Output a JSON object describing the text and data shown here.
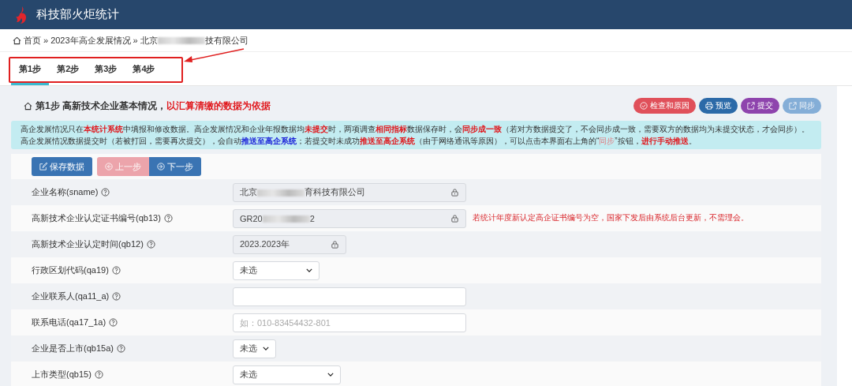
{
  "app": {
    "title": "科技部火炬统计"
  },
  "breadcrumb": {
    "home": "首页",
    "separator": "»",
    "items": [
      "2023年高企发展情况"
    ],
    "current_start": "北京",
    "current_end": "技有限公司"
  },
  "tabs": [
    {
      "label": "第1步",
      "selected": true
    },
    {
      "label": "第2步",
      "selected": false
    },
    {
      "label": "第3步",
      "selected": false
    },
    {
      "label": "第4步",
      "selected": false
    }
  ],
  "section": {
    "title": "第1步 高新技术企业基本情况，",
    "title_note": "以汇算清缴的数据为依据"
  },
  "actions": [
    {
      "label": "检查和原因",
      "kind": "check",
      "disabled": false
    },
    {
      "label": "预览",
      "kind": "print",
      "disabled": false
    },
    {
      "label": "提交",
      "kind": "submit",
      "disabled": false
    },
    {
      "label": "同步",
      "kind": "sync",
      "disabled": true
    }
  ],
  "notice": [
    {
      "text": "高企发展情况只在",
      "kind": "plain"
    },
    {
      "text": "本统计系统",
      "kind": "alert"
    },
    {
      "text": "中填报和修改数据。高企发展情况和企业年报数据均",
      "kind": "plain"
    },
    {
      "text": "未提交",
      "kind": "alert"
    },
    {
      "text": "时，两项调查",
      "kind": "plain"
    },
    {
      "text": "相同指标",
      "kind": "alert"
    },
    {
      "text": "数据保存时，会",
      "kind": "plain"
    },
    {
      "text": "同步成一致",
      "kind": "alert"
    },
    {
      "text": "（若对方数据提交了，不会同步成一致，需要双方的数据均为未提交状态，才会同步）。高企发展情况数据提交时（若被打回，需要再次提交），会自动",
      "kind": "plain"
    },
    {
      "text": "推送至高企系统",
      "kind": "link"
    },
    {
      "text": "；若提交时未成功",
      "kind": "plain"
    },
    {
      "text": "推送至高企系统",
      "kind": "alert"
    },
    {
      "text": "（由于网络通讯等原因），可以点击本界面右上角的“",
      "kind": "plain"
    },
    {
      "text": "同步",
      "kind": "quote"
    },
    {
      "text": "”按钮，",
      "kind": "plain"
    },
    {
      "text": "进行手动推送",
      "kind": "alert"
    },
    {
      "text": "。",
      "kind": "plain"
    }
  ],
  "toolbar": [
    {
      "label": "保存数据",
      "kind": "save",
      "disabled": false
    },
    {
      "label": "上一步",
      "kind": "prev",
      "disabled": true
    },
    {
      "label": "下一步",
      "kind": "next",
      "disabled": false
    }
  ],
  "fields": [
    {
      "label": "企业名称(sname)",
      "kind": "locked",
      "value_start": "北京",
      "value_end": "育科技有限公司"
    },
    {
      "label": "高新技术企业认定证书编号(qb13)",
      "kind": "locked",
      "value_start": "GR20",
      "value_end": "2",
      "note": "若统计年度新认定高企证书编号为空，国家下发后由系统后台更新，不需理会。"
    },
    {
      "label": "高新技术企业认定时间(qb12)",
      "kind": "locked",
      "value_start": "2023.2023年"
    },
    {
      "label": "行政区划代码(qa19)",
      "kind": "select",
      "value_start": "未选"
    },
    {
      "label": "企业联系人(qa11_a)",
      "kind": "text"
    },
    {
      "label": "联系电话(qa17_1a)",
      "kind": "text",
      "placeholder": "如：010-83454432-801"
    },
    {
      "label": "企业是否上市(qb15a)",
      "kind": "select",
      "value_start": "未选"
    },
    {
      "label": "上市类型(qb15)",
      "kind": "select",
      "value_start": "未选"
    }
  ]
}
